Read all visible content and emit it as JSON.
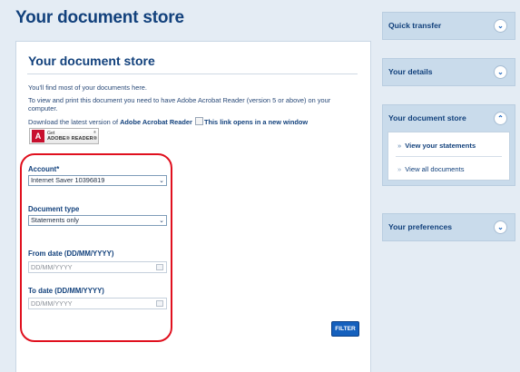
{
  "page": {
    "title": "Your document store"
  },
  "panel": {
    "title": "Your document store",
    "intro_line1": "You'll find most of your documents here.",
    "intro_line2": "To view and print this document you need to have Adobe Acrobat Reader (version 5 or above) on your computer.",
    "download_prefix": "Download the latest version of",
    "download_link": "Adobe Acrobat Reader",
    "new_window_alt": "This link opens in a new window",
    "adobe_badge": {
      "get": "Get",
      "product": "ADOBE® READER®",
      "reg": "®"
    }
  },
  "form": {
    "account_label": "Account*",
    "account_value": "Internet Saver 10396819",
    "doctype_label": "Document type",
    "doctype_value": "Statements only",
    "from_label": "From date (DD/MM/YYYY)",
    "from_placeholder": "DD/MM/YYYY",
    "to_label": "To date (DD/MM/YYYY)",
    "to_placeholder": "DD/MM/YYYY",
    "filter_label": "FILTER"
  },
  "sidebar": {
    "quick_transfer": "Quick transfer",
    "your_details": "Your details",
    "document_store": "Your document store",
    "view_statements": "View your statements",
    "view_all": "View all documents",
    "preferences": "Your preferences"
  },
  "colors": {
    "accent": "#1560bd",
    "highlight": "#e0101e",
    "heading": "#12417c"
  }
}
